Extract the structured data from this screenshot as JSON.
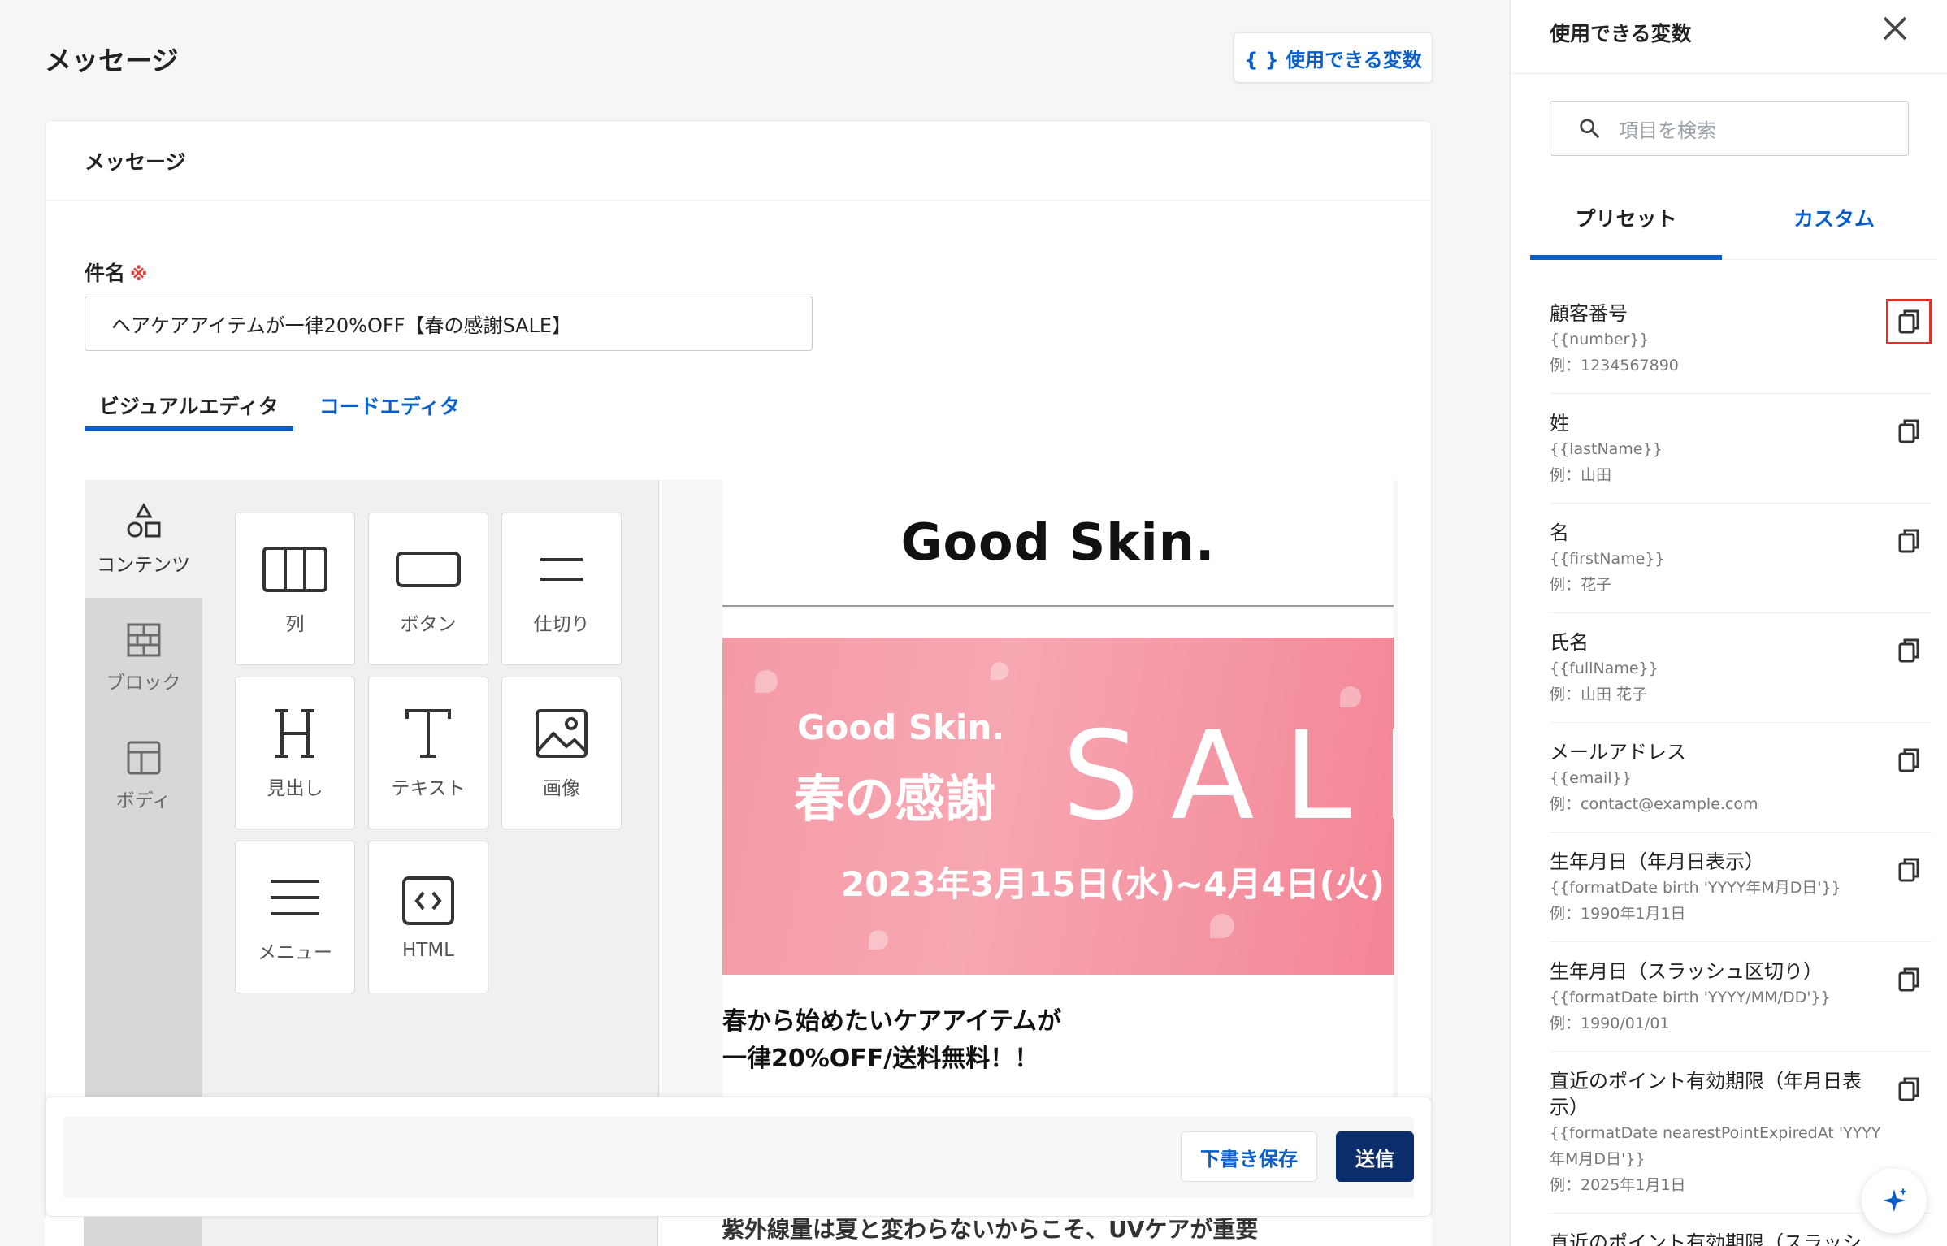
{
  "header": {
    "title": "メッセージ",
    "vars_button": "{ } 使用できる変数"
  },
  "card": {
    "title": "メッセージ",
    "subject_label": "件名",
    "required_mark": "※",
    "subject_value": "ヘアケアアイテムが一律20%OFF【春の感謝SALE】",
    "tabs": [
      {
        "label": "ビジュアルエディタ"
      },
      {
        "label": "コードエディタ"
      }
    ]
  },
  "editor": {
    "side": [
      {
        "label": "コンテンツ"
      },
      {
        "label": "ブロック"
      },
      {
        "label": "ボディ"
      }
    ],
    "tiles": [
      {
        "label": "列",
        "icon": "columns-icon"
      },
      {
        "label": "ボタン",
        "icon": "button-icon"
      },
      {
        "label": "仕切り",
        "icon": "divider-icon"
      },
      {
        "label": "見出し",
        "icon": "heading-icon"
      },
      {
        "label": "テキスト",
        "icon": "text-icon"
      },
      {
        "label": "画像",
        "icon": "image-icon"
      },
      {
        "label": "メニュー",
        "icon": "menu-icon"
      },
      {
        "label": "HTML",
        "icon": "html-icon"
      }
    ]
  },
  "preview": {
    "logo": "Good Skin.",
    "banner_brand": "Good Skin.",
    "banner_title": "春の感謝",
    "banner_sale": "SALE",
    "banner_date": "2023年3月15日(水)~4月4日(火)",
    "heading_line1": "春から始めたいケアアイテムが",
    "heading_line2": "一律20%OFF/送料無料！！",
    "partial_text": "紫外線量は夏と変わらないからこそ、UVケアが重要"
  },
  "footer": {
    "draft": "下書き保存",
    "send": "送信"
  },
  "panel": {
    "title": "使用できる変数",
    "search_placeholder": "項目を検索",
    "tabs": [
      {
        "label": "プリセット"
      },
      {
        "label": "カスタム"
      }
    ],
    "variables": [
      {
        "name": "顧客番号",
        "code": "{{number}}",
        "example": "例：1234567890"
      },
      {
        "name": "姓",
        "code": "{{lastName}}",
        "example": "例：山田"
      },
      {
        "name": "名",
        "code": "{{firstName}}",
        "example": "例：花子"
      },
      {
        "name": "氏名",
        "code": "{{fullName}}",
        "example": "例：山田 花子"
      },
      {
        "name": "メールアドレス",
        "code": "{{email}}",
        "example": "例：contact@example.com"
      },
      {
        "name": "生年月日（年月日表示）",
        "code": "{{formatDate birth 'YYYY年M月D日'}}",
        "example": "例：1990年1月1日"
      },
      {
        "name": "生年月日（スラッシュ区切り）",
        "code": "{{formatDate birth 'YYYY/MM/DD'}}",
        "example": "例：1990/01/01"
      },
      {
        "name": "直近のポイント有効期限（年月日表示）",
        "code": "{{formatDate nearestPointExpiredAt 'YYYY年M月D日'}}",
        "example": "例：2025年1月1日"
      },
      {
        "name": "直近のポイント有効期限（スラッシュ区切り）",
        "code": "",
        "example": ""
      }
    ]
  },
  "colors": {
    "accent": "#0a5fc9",
    "primary_dark": "#0c2d6b",
    "required": "#e0443e",
    "highlight": "#e0302a"
  }
}
